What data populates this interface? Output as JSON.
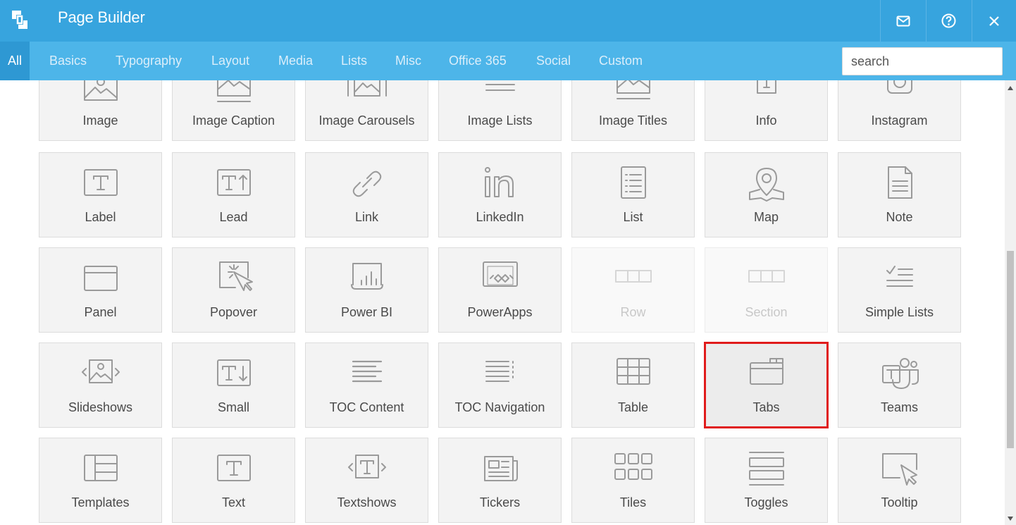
{
  "header": {
    "title": "Page Builder",
    "logo_icon": "page-builder-logo-icon",
    "actions": [
      {
        "name": "mail-icon"
      },
      {
        "name": "help-icon"
      },
      {
        "name": "close-icon"
      }
    ]
  },
  "categories": [
    "All",
    "Basics",
    "Typography",
    "Layout",
    "Media",
    "Lists",
    "Misc",
    "Office 365",
    "Social",
    "Custom"
  ],
  "active_category": "All",
  "search": {
    "placeholder": "search",
    "value": ""
  },
  "tiles": [
    {
      "label": "Image",
      "icon": "image-icon",
      "state": "normal"
    },
    {
      "label": "Image Caption",
      "icon": "image-caption-icon",
      "state": "normal"
    },
    {
      "label": "Image Carousels",
      "icon": "image-carousel-icon",
      "state": "normal"
    },
    {
      "label": "Image Lists",
      "icon": "image-list-icon",
      "state": "normal"
    },
    {
      "label": "Image Titles",
      "icon": "image-title-icon",
      "state": "normal"
    },
    {
      "label": "Info",
      "icon": "info-icon",
      "state": "normal"
    },
    {
      "label": "Instagram",
      "icon": "instagram-icon",
      "state": "normal"
    },
    {
      "label": "Label",
      "icon": "label-icon",
      "state": "normal"
    },
    {
      "label": "Lead",
      "icon": "lead-icon",
      "state": "normal"
    },
    {
      "label": "Link",
      "icon": "link-icon",
      "state": "normal"
    },
    {
      "label": "LinkedIn",
      "icon": "linkedin-icon",
      "state": "normal"
    },
    {
      "label": "List",
      "icon": "list-icon",
      "state": "normal"
    },
    {
      "label": "Map",
      "icon": "map-pin-icon",
      "state": "normal"
    },
    {
      "label": "Note",
      "icon": "note-icon",
      "state": "normal"
    },
    {
      "label": "Panel",
      "icon": "panel-icon",
      "state": "normal"
    },
    {
      "label": "Popover",
      "icon": "popover-icon",
      "state": "normal"
    },
    {
      "label": "Power BI",
      "icon": "power-bi-icon",
      "state": "normal"
    },
    {
      "label": "PowerApps",
      "icon": "powerapps-icon",
      "state": "normal"
    },
    {
      "label": "Row",
      "icon": "row-icon",
      "state": "disabled"
    },
    {
      "label": "Section",
      "icon": "section-icon",
      "state": "disabled"
    },
    {
      "label": "Simple Lists",
      "icon": "simple-list-icon",
      "state": "normal"
    },
    {
      "label": "Slideshows",
      "icon": "slideshow-icon",
      "state": "normal"
    },
    {
      "label": "Small",
      "icon": "small-icon",
      "state": "normal"
    },
    {
      "label": "TOC Content",
      "icon": "toc-content-icon",
      "state": "normal"
    },
    {
      "label": "TOC Navigation",
      "icon": "toc-navigation-icon",
      "state": "normal"
    },
    {
      "label": "Table",
      "icon": "table-icon",
      "state": "normal"
    },
    {
      "label": "Tabs",
      "icon": "tabs-icon",
      "state": "selected"
    },
    {
      "label": "Teams",
      "icon": "teams-icon",
      "state": "normal"
    },
    {
      "label": "Templates",
      "icon": "templates-icon",
      "state": "normal"
    },
    {
      "label": "Text",
      "icon": "text-icon",
      "state": "normal"
    },
    {
      "label": "Textshows",
      "icon": "textshow-icon",
      "state": "normal"
    },
    {
      "label": "Tickers",
      "icon": "ticker-icon",
      "state": "normal"
    },
    {
      "label": "Tiles",
      "icon": "tiles-icon",
      "state": "normal"
    },
    {
      "label": "Toggles",
      "icon": "toggles-icon",
      "state": "normal"
    },
    {
      "label": "Tooltip",
      "icon": "tooltip-icon",
      "state": "normal"
    }
  ],
  "colors": {
    "header": "#37a4de",
    "category_bar": "#4db5e9",
    "active_category": "#2e98d3",
    "selection": "#e01b1b"
  }
}
